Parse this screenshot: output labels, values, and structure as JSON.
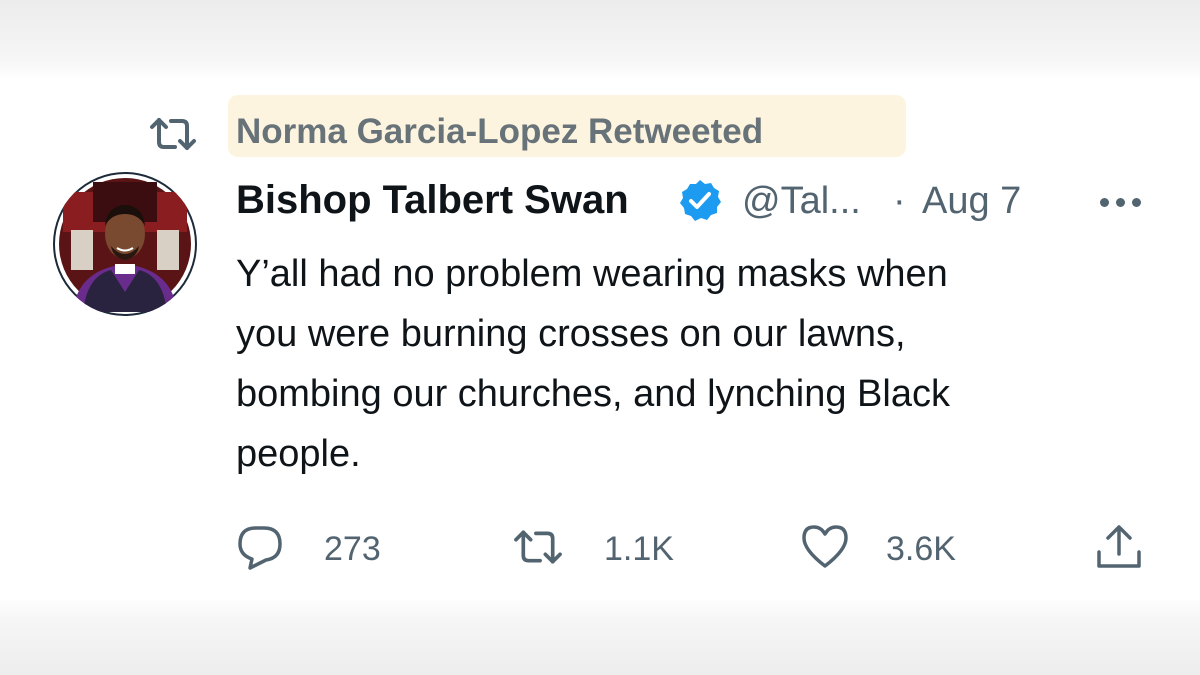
{
  "retweet_banner": {
    "icon": "retweet-icon",
    "text": "Norma Garcia-Lopez Retweeted",
    "highlight_color": "#fdf4df"
  },
  "tweet": {
    "author_name": "Bishop Talbert Swan",
    "verified": true,
    "verified_color": "#1d9bf0",
    "handle": "@Tal...",
    "separator": "·",
    "date": "Aug 7",
    "text_lines": [
      "Y’all had no problem wearing masks when",
      "you were burning crosses on our lawns,",
      "bombing our churches, and lynching Black",
      "people."
    ]
  },
  "actions": {
    "reply": {
      "icon": "reply-icon",
      "count": "273"
    },
    "retweet": {
      "icon": "retweet-icon",
      "count": "1.1K"
    },
    "like": {
      "icon": "heart-icon",
      "count": "3.6K"
    },
    "share": {
      "icon": "share-icon"
    }
  },
  "colors": {
    "text_primary": "#0f1419",
    "text_secondary": "#536471"
  }
}
